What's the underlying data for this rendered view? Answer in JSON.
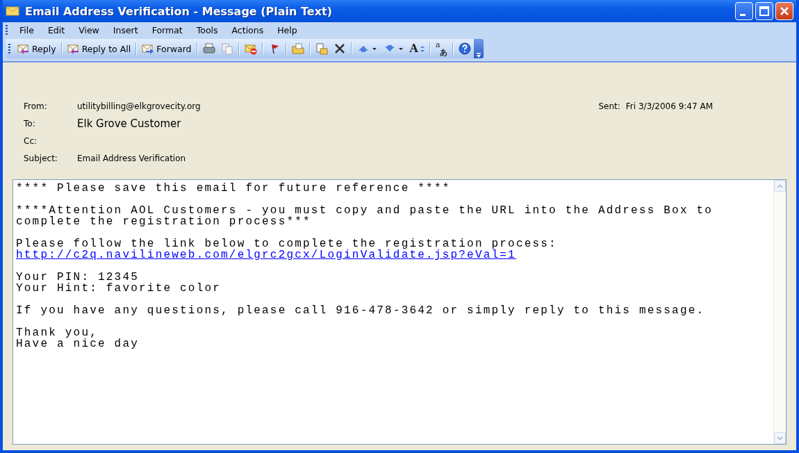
{
  "window": {
    "title": "Email Address Verification - Message (Plain Text)"
  },
  "menu": [
    "File",
    "Edit",
    "View",
    "Insert",
    "Format",
    "Tools",
    "Actions",
    "Help"
  ],
  "toolbar": [
    {
      "kind": "reply",
      "label": "Reply"
    },
    {
      "kind": "separator"
    },
    {
      "kind": "reply_all",
      "label": "Reply to All"
    },
    {
      "kind": "separator"
    },
    {
      "kind": "forward",
      "label": "Forward"
    },
    {
      "kind": "separator"
    },
    {
      "kind": "print"
    },
    {
      "kind": "copy"
    },
    {
      "kind": "separator"
    },
    {
      "kind": "no_mail"
    },
    {
      "kind": "separator"
    },
    {
      "kind": "flag"
    },
    {
      "kind": "separator"
    },
    {
      "kind": "move"
    },
    {
      "kind": "separator"
    },
    {
      "kind": "paste"
    },
    {
      "kind": "delete"
    },
    {
      "kind": "separator"
    },
    {
      "kind": "previous"
    },
    {
      "kind": "next"
    },
    {
      "kind": "font_size",
      "glyph": "A"
    },
    {
      "kind": "separator"
    },
    {
      "kind": "encoding",
      "glyph": "a",
      "glyph_2": "あ"
    },
    {
      "kind": "separator"
    },
    {
      "kind": "help"
    }
  ],
  "header": {
    "from": {
      "label": "From:",
      "value": "utilitybilling@elkgrovecity.org"
    },
    "sent": {
      "label": "Sent:",
      "value": "Fri 3/3/2006 9:47 AM"
    },
    "to": {
      "label": "To:",
      "value": "Elk Grove Customer"
    },
    "cc": {
      "label": "Cc:"
    },
    "subject": {
      "label": "Subject:",
      "value": "Email Address Verification"
    }
  },
  "body": [
    {
      "lines": [
        {
          "kind": "text",
          "text": "**** Please save this email for future reference ****"
        }
      ]
    },
    {
      "lines": [
        {
          "kind": "text",
          "text": "****Attention AOL Customers - you must copy and paste the URL into the Address Box to"
        },
        {
          "kind": "text",
          "text": "complete the registration process***"
        }
      ]
    },
    {
      "lines": [
        {
          "kind": "text",
          "text": "Please follow the link below to complete the registration process:"
        },
        {
          "kind": "link",
          "text": "http://c2q.navilineweb.com/elgrc2gcx/LoginValidate.jsp?eVal=1"
        }
      ]
    },
    {
      "lines": [
        {
          "kind": "text",
          "text": "Your PIN: 12345"
        },
        {
          "kind": "text",
          "text": "Your Hint: favorite color"
        }
      ]
    },
    {
      "lines": [
        {
          "kind": "text",
          "text": "If you have any questions, please call 916-478-3642 or simply reply to this message."
        }
      ]
    },
    {
      "lines": [
        {
          "kind": "text",
          "text": "Thank you,"
        },
        {
          "kind": "text",
          "text": "Have a nice day"
        }
      ]
    }
  ]
}
